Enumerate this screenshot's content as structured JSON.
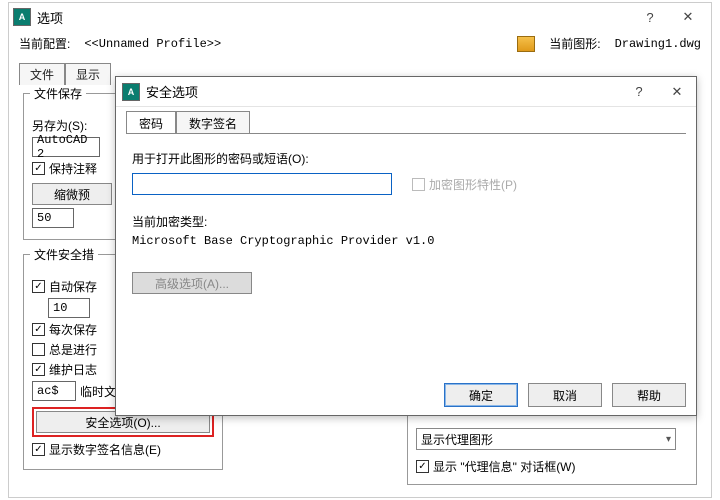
{
  "options": {
    "title": "选项",
    "current_profile_label": "当前配置:",
    "profile_value": "<<Unnamed Profile>>",
    "current_drawing_label": "当前图形:",
    "drawing_value": "Drawing1.dwg",
    "tabs": {
      "file": "文件",
      "display": "显示"
    },
    "group_save": {
      "title": "文件保存",
      "save_as_label": "另存为(S):",
      "format_value": "AutoCAD 2",
      "keep_annot": "保持注释",
      "thumb_btn": "缩微预",
      "increment_value": "50"
    },
    "group_safety": {
      "title": "文件安全措",
      "autosave": "自动保存",
      "autosave_value": "10",
      "backup_each": "每次保存",
      "always_check": "总是进行",
      "maintain_log": "维护日志",
      "temp_ext_value": "ac$",
      "temp_ext_label": "临时文件的扩展名(P)",
      "security_btn": "安全选项(O)...",
      "show_sig": "显示数字签名信息(E)"
    },
    "proxy": {
      "show_proxy_label": "显示代理图形",
      "show_proxy_dialog": "显示 \"代理信息\" 对话框(W)"
    }
  },
  "security": {
    "title": "安全选项",
    "tabs": {
      "password": "密码",
      "signature": "数字签名"
    },
    "pw_label": "用于打开此图形的密码或短语(O):",
    "encrypt_props_label": "加密图形特性(P)",
    "enc_type_label": "当前加密类型:",
    "enc_type_value": "Microsoft Base Cryptographic Provider v1.0",
    "advanced_btn": "高级选项(A)...",
    "ok": "确定",
    "cancel": "取消",
    "help": "帮助"
  }
}
